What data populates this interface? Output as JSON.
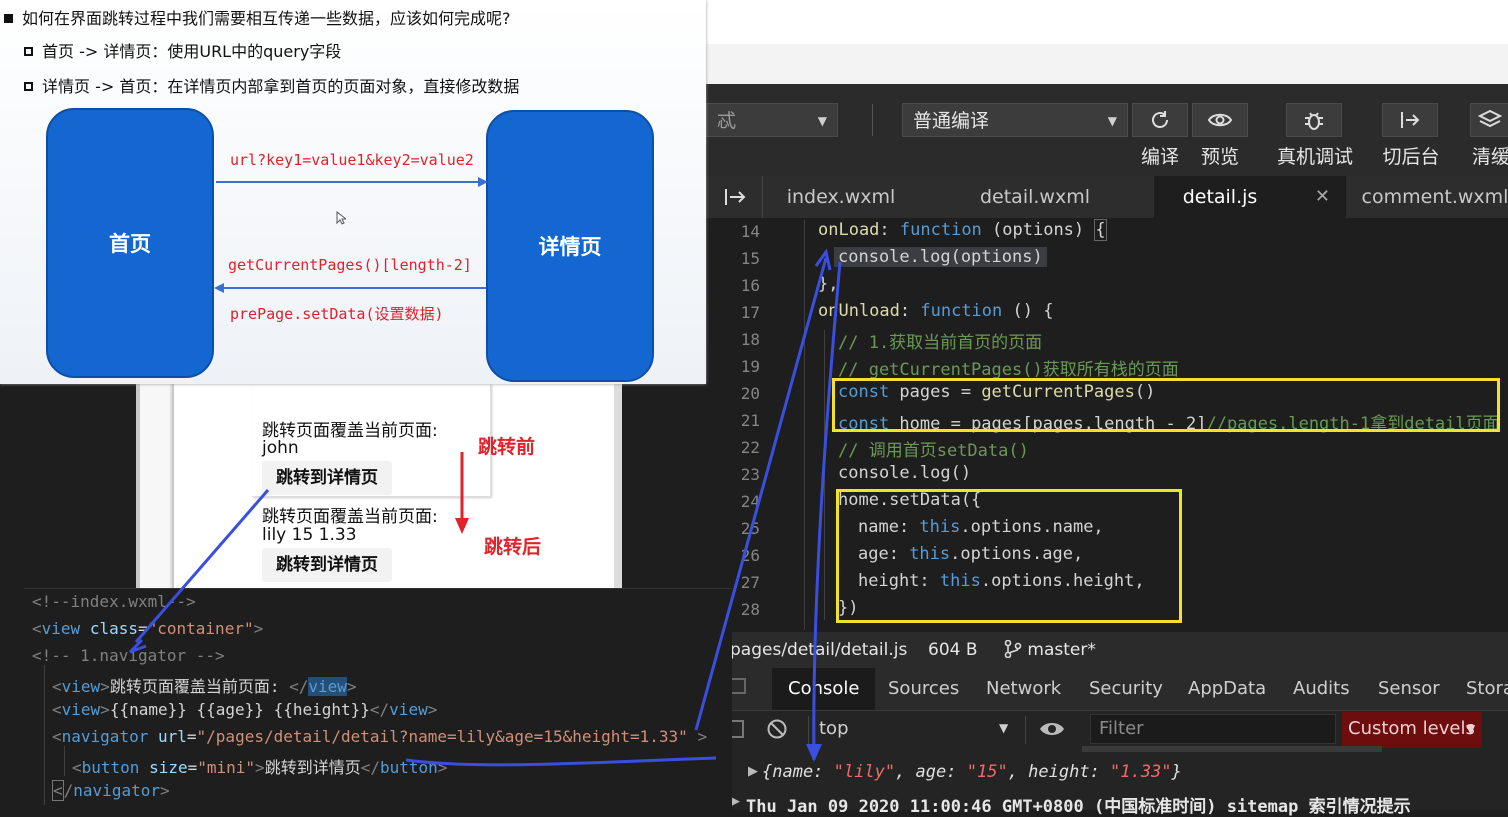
{
  "slide": {
    "title": "如何在界面跳转过程中我们需要相互传递一些数据，应该如何完成呢?",
    "bullet1": "首页 -> 详情页：使用URL中的query字段",
    "bullet2": "详情页 -> 首页：在详情页内部拿到首页的页面对象，直接修改数据",
    "home_box": "首页",
    "detail_box": "详情页",
    "url_label": "url?key1=value1&key2=value2",
    "get_pages_label": "getCurrentPages()[length-2]",
    "setdata_label": "prePage.setData(设置数据)"
  },
  "toolbar": {
    "compile_mode": "普通编译",
    "buttons": [
      {
        "label": "编译",
        "icon": "refresh-icon"
      },
      {
        "label": "预览",
        "icon": "eye-icon"
      },
      {
        "label": "真机调试",
        "icon": "bug-icon"
      },
      {
        "label": "切后台",
        "icon": "switch-icon"
      },
      {
        "label": "清缓",
        "icon": "layers-icon"
      }
    ],
    "left_select_partial": "忒"
  },
  "tabs": [
    {
      "label": "index.wxml"
    },
    {
      "label": "detail.wxml"
    },
    {
      "label": "detail.js"
    },
    {
      "label": "comment.wxml"
    }
  ],
  "editor": {
    "line_numbers": [
      "14",
      "15",
      "16",
      "17",
      "18",
      "19",
      "20",
      "21",
      "22",
      "23",
      "24",
      "25",
      "26",
      "27",
      "28"
    ]
  },
  "status": {
    "path": "pages/detail/detail.js",
    "size": "604 B",
    "branch": "master*"
  },
  "devtools": {
    "tabs": [
      "Console",
      "Sources",
      "Network",
      "Security",
      "AppData",
      "Audits",
      "Sensor",
      "Stora"
    ],
    "context": "top",
    "filter_placeholder": "Filter",
    "levels": "Custom levels"
  },
  "console": {
    "log_line": "{name: \"lily\", age: \"15\", height: \"1.33\"}",
    "log_prefix": "{name: ",
    "v_name": "\"lily\"",
    "k_age": ", age: ",
    "v_age": "\"15\"",
    "k_height": ", height: ",
    "v_height": "\"1.33\"",
    "log_suffix": "}",
    "date_line": "Thu Jan 09 2020 11:00:46 GMT+0800 (中国标准时间) sitemap 索引情况提示"
  },
  "phone": {
    "line1": "跳转页面覆盖当前页面:",
    "name_before": "john",
    "button": "跳转到详情页",
    "line2": "跳转页面覆盖当前页面:",
    "values_after": "lily 15 1.33",
    "label_before": "跳转前",
    "label_after": "跳转后"
  },
  "wxml": {
    "c1": "<!--index.wxml-->",
    "c2": "<!-- 1.navigator -->",
    "l4_text": "跳转页面覆盖当前页面:",
    "l5_text": "{{name}} {{age}} {{height}}",
    "url_value": "\"/pages/detail/detail?name=lily&age=15&height=1.33\"",
    "button_text": "跳转到详情页"
  },
  "colors": {
    "blue_box": "#1467d0",
    "red_text": "#e0222a",
    "annotation_yellow": "#f2e229",
    "annotation_blue": "#3a4fe0"
  }
}
